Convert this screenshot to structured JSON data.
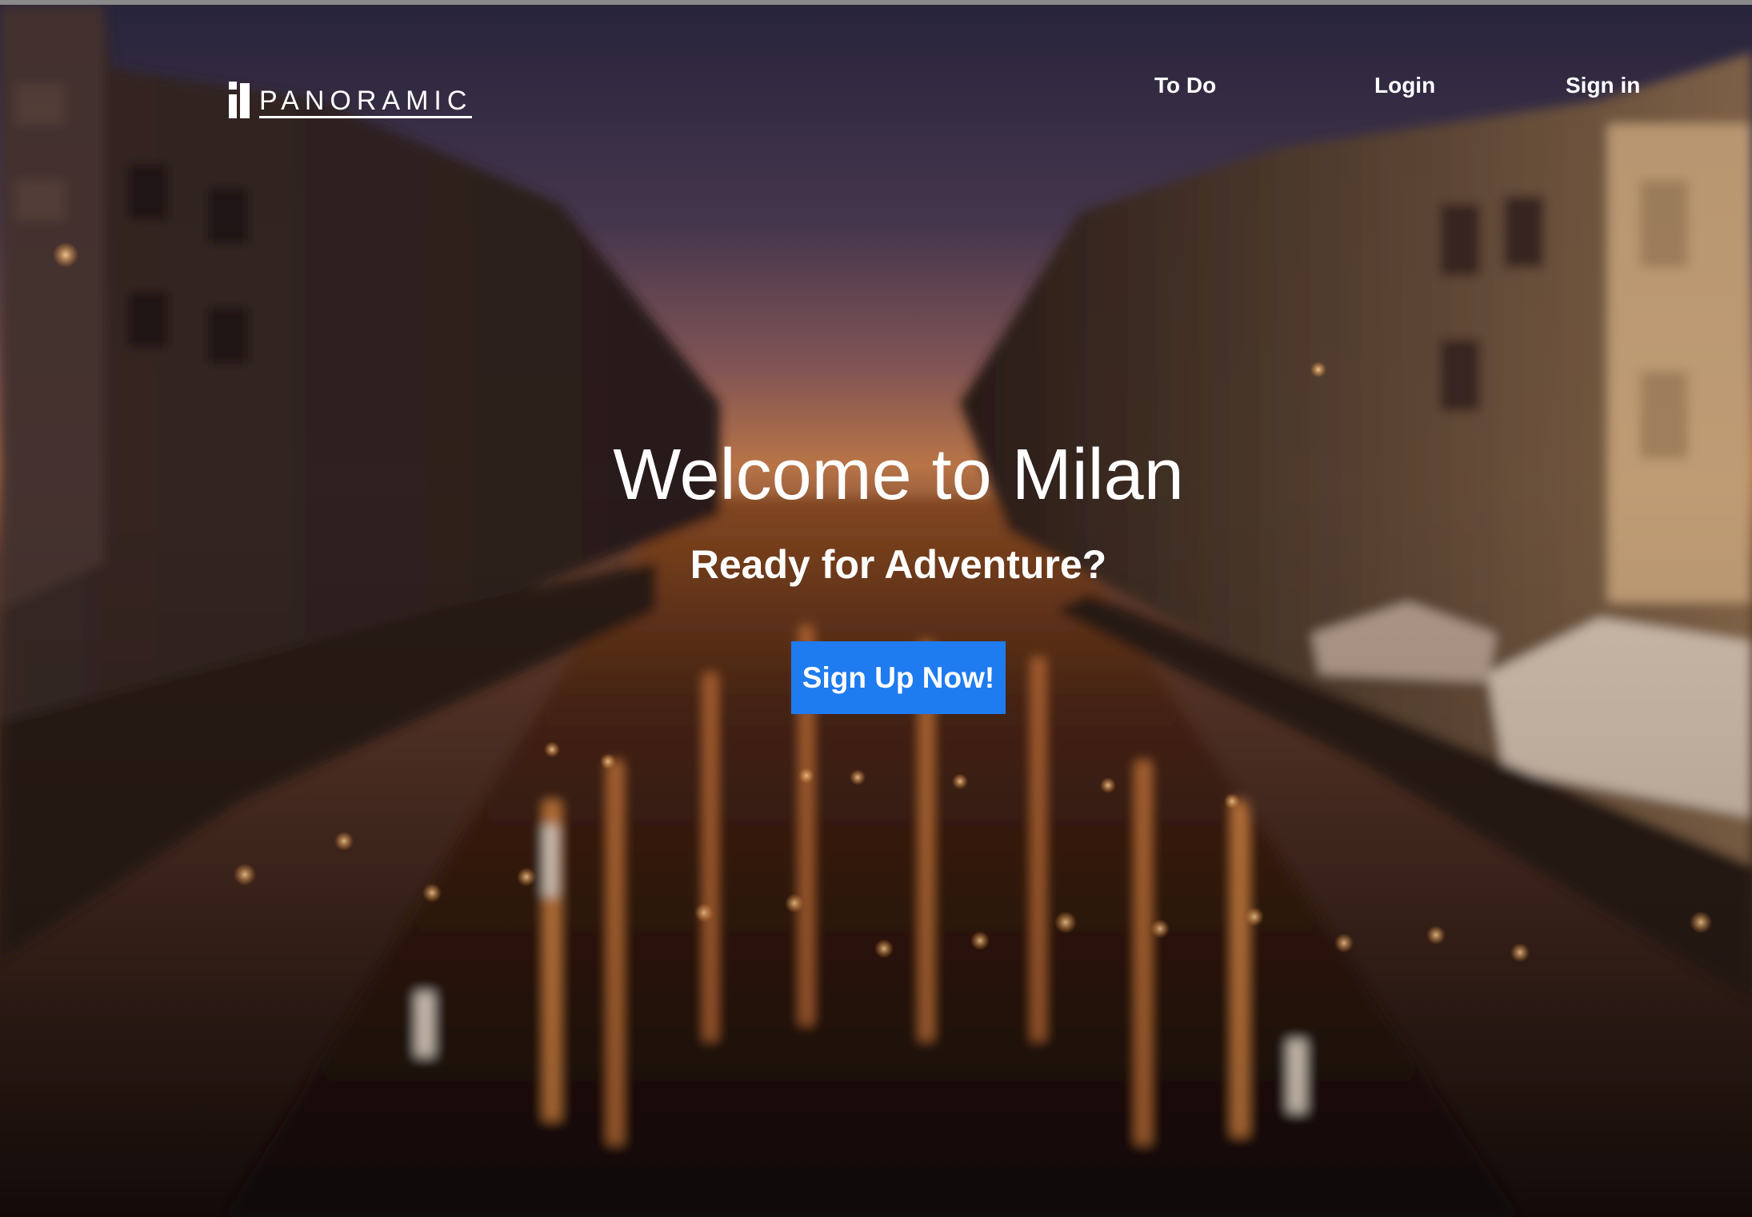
{
  "brand": {
    "name": "PANORAMIC"
  },
  "nav": {
    "items": [
      {
        "label": "To Do"
      },
      {
        "label": "Login"
      },
      {
        "label": "Sign in"
      }
    ]
  },
  "hero": {
    "title": "Welcome to Milan",
    "subtitle": "Ready for Adventure?",
    "cta_label": "Sign Up Now!",
    "background": "Milan canal at dusk (Navigli)"
  },
  "colors": {
    "cta": "#1f7bf0",
    "text": "#ffffff"
  }
}
